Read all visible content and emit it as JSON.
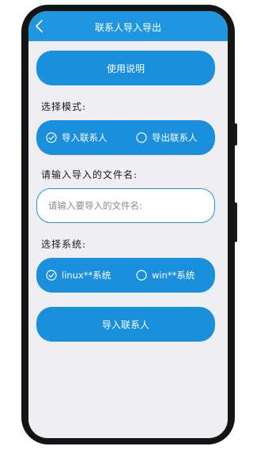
{
  "header": {
    "title": "联系人导入导出",
    "back_icon": "chevron-left-icon"
  },
  "instructions_button": {
    "label": "使用说明"
  },
  "mode_section": {
    "label": "选择模式:",
    "options": [
      {
        "label": "导入联系人",
        "selected": true
      },
      {
        "label": "导出联系人",
        "selected": false
      }
    ]
  },
  "filename_section": {
    "label": "请输入导入的文件名:",
    "input": {
      "value": "",
      "placeholder": "请输入要导入的文件名:"
    }
  },
  "system_section": {
    "label": "选择系统:",
    "options": [
      {
        "label": "linux**系统",
        "selected": true
      },
      {
        "label": "win**系统",
        "selected": false
      }
    ]
  },
  "action_button": {
    "label": "导入联系人"
  },
  "colors": {
    "accent": "#1a8fdb",
    "header": "#2196e0",
    "background": "#eeeef3"
  }
}
